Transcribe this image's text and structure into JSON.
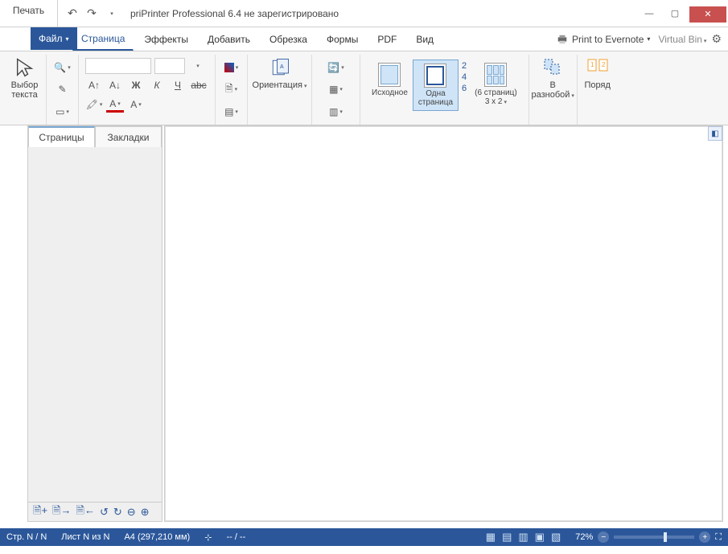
{
  "title": "priPrinter Professional 6.4 не зарегистрировано",
  "print_tab": "Печать",
  "file_menu": "Файл",
  "tabs": [
    "Страница",
    "Эффекты",
    "Добавить",
    "Обрезка",
    "Формы",
    "PDF",
    "Вид"
  ],
  "printer": "Print to Evernote",
  "virtual_bin": "Virtual Bin",
  "ribbon": {
    "select_text": "Выбор\nтекста",
    "orientation": "Ориентация",
    "original": "Исходное",
    "one_page": "Одна\nстраница",
    "six_pages": "(6 страниц)\n3 x 2",
    "random": "В\nразнобой",
    "order": "Поряд",
    "nums": [
      "2",
      "4",
      "6"
    ]
  },
  "side_tabs": {
    "pages": "Страницы",
    "bookmarks": "Закладки"
  },
  "status": {
    "page": "Стр. N / N",
    "sheet": "Лист N из N",
    "size": "A4 (297,210 мм)",
    "pos": "-- / --",
    "zoom": "72%"
  }
}
